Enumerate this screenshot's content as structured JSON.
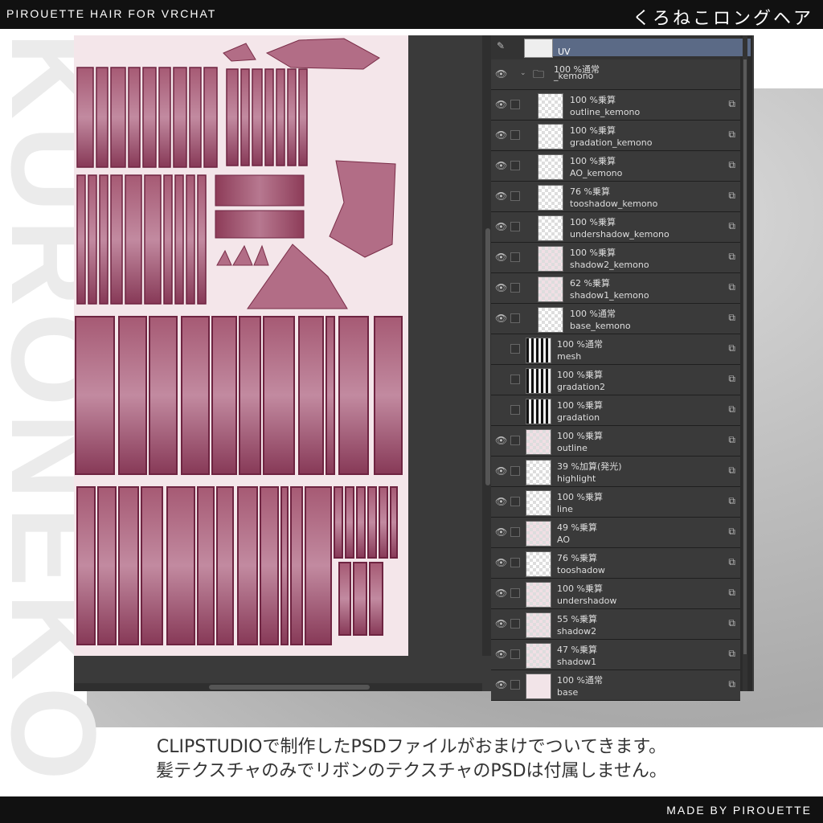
{
  "header": {
    "left_title": "PIROUETTE HAIR FOR VRCHAT",
    "right_title": "くろねこロングヘア"
  },
  "watermark": {
    "text": "KURONEKO"
  },
  "footer": {
    "credit": "MADE BY PIROUETTE"
  },
  "caption": {
    "line1": "CLIPSTUDIOで制作したPSDファイルがおまけでついてきます。",
    "line2": "髪テクスチャのみでリボンのテクスチャのPSDは付属しません。"
  },
  "layers_panel": {
    "top_layer_name": "UV",
    "folder": {
      "mode": "100 %通常",
      "name": "_kemono"
    },
    "layers": [
      {
        "mode": "100 %乗算",
        "name": "outline_kemono",
        "indent": true,
        "visible": true
      },
      {
        "mode": "100 %乗算",
        "name": "gradation_kemono",
        "indent": true,
        "visible": true
      },
      {
        "mode": "100 %乗算",
        "name": "AO_kemono",
        "indent": true,
        "visible": true
      },
      {
        "mode": "76 %乗算",
        "name": "tooshadow_kemono",
        "indent": true,
        "visible": true
      },
      {
        "mode": "100 %乗算",
        "name": "undershadow_kemono",
        "indent": true,
        "visible": true
      },
      {
        "mode": "100 %乗算",
        "name": "shadow2_kemono",
        "indent": true,
        "visible": true
      },
      {
        "mode": "62 %乗算",
        "name": "shadow1_kemono",
        "indent": true,
        "visible": true
      },
      {
        "mode": "100 %通常",
        "name": "base_kemono",
        "indent": true,
        "visible": true
      },
      {
        "mode": "100 %通常",
        "name": "mesh",
        "indent": false,
        "visible": false
      },
      {
        "mode": "100 %乗算",
        "name": "gradation2",
        "indent": false,
        "visible": false
      },
      {
        "mode": "100 %乗算",
        "name": "gradation",
        "indent": false,
        "visible": false
      },
      {
        "mode": "100 %乗算",
        "name": "outline",
        "indent": false,
        "visible": true
      },
      {
        "mode": "39 %加算(発光)",
        "name": "highlight",
        "indent": false,
        "visible": true
      },
      {
        "mode": "100 %乗算",
        "name": "line",
        "indent": false,
        "visible": true
      },
      {
        "mode": "49 %乗算",
        "name": "AO",
        "indent": false,
        "visible": true
      },
      {
        "mode": "76 %乗算",
        "name": "tooshadow",
        "indent": false,
        "visible": true
      },
      {
        "mode": "100 %乗算",
        "name": "undershadow",
        "indent": false,
        "visible": true
      },
      {
        "mode": "55 %乗算",
        "name": "shadow2",
        "indent": false,
        "visible": true
      },
      {
        "mode": "47 %乗算",
        "name": "shadow1",
        "indent": false,
        "visible": true
      },
      {
        "mode": "100 %通常",
        "name": "base",
        "indent": false,
        "visible": true
      }
    ]
  },
  "colors": {
    "canvas_bg": "#f4e6ea",
    "hair_pink": "#a3566f",
    "hair_dark": "#7a2d48",
    "panel_bg": "#2b2b2b",
    "selected_layer": "#5b6a86"
  },
  "icons": {
    "visibility": "eye-icon",
    "folder": "folder-icon",
    "layer_fx": "layer-property-icon",
    "pen": "pen-icon"
  }
}
